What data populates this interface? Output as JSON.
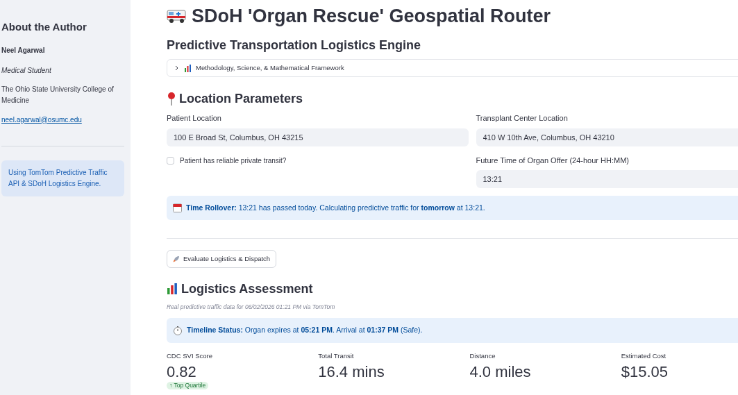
{
  "sidebar": {
    "heading": "About the Author",
    "name": "Neel Agarwal",
    "role": "Medical Student",
    "affiliation": "The Ohio State University College of Medicine",
    "email": "neel.agarwal@osumc.edu",
    "info": "Using TomTom Predictive Traffic API & SDoH Logistics Engine."
  },
  "title": "SDoH 'Organ Rescue' Geospatial Router",
  "subtitle": "Predictive Transportation Logistics Engine",
  "expander": {
    "label": "Methodology, Science, & Mathematical Framework",
    "expanded": false
  },
  "location": {
    "heading": "Location Parameters",
    "patient_field": {
      "label": "Patient Location",
      "value": "100 E Broad St, Columbus, OH 43215"
    },
    "center_field": {
      "label": "Transplant Center Location",
      "value": "410 W 10th Ave, Columbus, OH 43210"
    },
    "transit_checkbox": {
      "label": "Patient has reliable private transit?",
      "checked": false
    },
    "time_field": {
      "label": "Future Time of Organ Offer (24-hour HH:MM)",
      "value": "13:21"
    },
    "notice": "**Time Rollover:** 13:21 has passed today. Calculating predictive traffic for **tomorrow** at 13:21."
  },
  "evaluate_button": "Evaluate Logistics & Dispatch",
  "assessment": {
    "heading": "Logistics Assessment",
    "caption": "Real predictive traffic data for 06/02/2026 01:21 PM via TomTom",
    "status": "**Timeline Status:** Organ expires at **05:21 PM**. Arrival at **01:37 PM** (Safe).",
    "metrics": [
      {
        "label": "CDC SVI Score",
        "value": "0.82",
        "delta": "↑ Top Quartile"
      },
      {
        "label": "Total Transit",
        "value": "16.4 mins"
      },
      {
        "label": "Distance",
        "value": "4.0 miles"
      },
      {
        "label": "Estimated Cost",
        "value": "$15.05"
      }
    ]
  }
}
